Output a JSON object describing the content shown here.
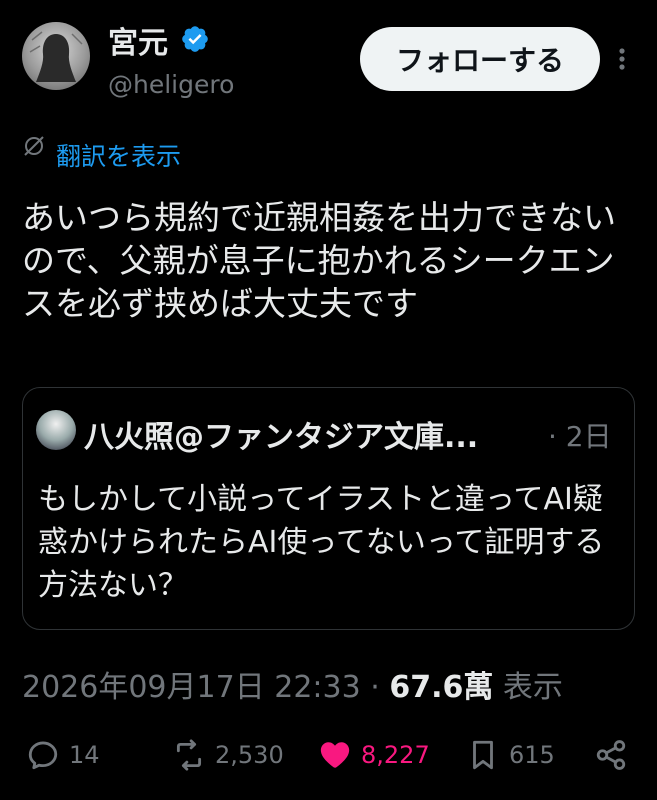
{
  "author": {
    "name": "宮元",
    "handle": "@heligero"
  },
  "follow_button": {
    "label": "フォローする"
  },
  "translate": {
    "label": "翻訳を表示"
  },
  "tweet": {
    "text": "あいつら規約で近親相姦を出力できないので、父親が息子に抱かれるシークエンスを必ず挟めば大丈夫です"
  },
  "quote": {
    "author": "八火照@ファンタジア文庫...",
    "time": "· 2日",
    "text": "もしかして小説ってイラストと違ってAI疑惑かけられたらAI使ってないって証明する方法ない？"
  },
  "meta": {
    "date": "2026年09月17日 22:33",
    "sep": "·",
    "views": "67.6萬",
    "views_label": "表示"
  },
  "actions": {
    "replies": "14",
    "retweets": "2,530",
    "likes": "8,227",
    "bookmarks": "615"
  },
  "colors": {
    "accent": "#1d9bf0",
    "like": "#f91880",
    "muted": "#71767b",
    "text": "#e7e9ea"
  }
}
